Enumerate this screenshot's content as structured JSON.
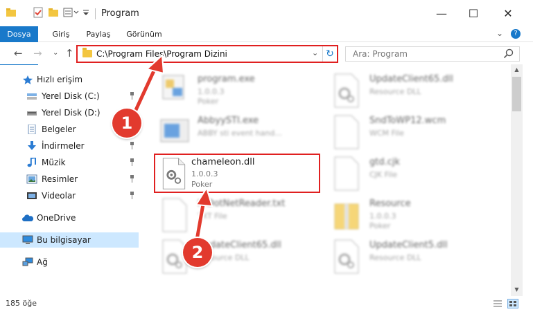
{
  "window": {
    "title": "Program",
    "minimize": "—",
    "maximize": "☐",
    "close": "✕"
  },
  "ribbon": {
    "tabs": [
      "Dosya",
      "Giriş",
      "Paylaş",
      "Görünüm"
    ],
    "expand_glyph": "⌄",
    "help_glyph": "?"
  },
  "navigation": {
    "back": "←",
    "forward": "→",
    "recent": "⌄",
    "up": "↑",
    "address": "C:\\Program Files\\Program Dizini",
    "address_dropdown": "⌄",
    "refresh": "↻",
    "search_placeholder": "Ara: Program"
  },
  "sidebar": {
    "items": [
      {
        "label": "Hızlı erişim",
        "icon": "star-icon",
        "pinned": false
      },
      {
        "label": "Yerel Disk (C:)",
        "icon": "drive-icon",
        "pinned": true
      },
      {
        "label": "Yerel Disk (D:)",
        "icon": "drive-icon",
        "pinned": true
      },
      {
        "label": "Belgeler",
        "icon": "documents-icon",
        "pinned": true
      },
      {
        "label": "İndirmeler",
        "icon": "download-icon",
        "pinned": true
      },
      {
        "label": "Müzik",
        "icon": "music-icon",
        "pinned": true
      },
      {
        "label": "Resimler",
        "icon": "pictures-icon",
        "pinned": true
      },
      {
        "label": "Videolar",
        "icon": "videos-icon",
        "pinned": true
      },
      {
        "label": "OneDrive",
        "icon": "cloud-icon",
        "pinned": false
      },
      {
        "label": "Bu bilgisayar",
        "icon": "computer-icon",
        "pinned": false
      },
      {
        "label": "Ağ",
        "icon": "network-icon",
        "pinned": false
      }
    ]
  },
  "files": [
    {
      "name": "program.exe",
      "line1": "1.0.0.3",
      "line2": "Poker",
      "icon": "exe-icon"
    },
    {
      "name": "UpdateClient65.dll",
      "line1": "Resource DLL",
      "line2": "",
      "icon": "dll-gear-icon"
    },
    {
      "name": "AbbyySTI.exe",
      "line1": "ABBY sti event hand...",
      "line2": "",
      "icon": "app-window-icon"
    },
    {
      "name": "SndToWP12.wcm",
      "line1": "WCM File",
      "line2": "",
      "icon": "blank-file-icon"
    },
    {
      "name": "chameleon.dll",
      "line1": "1.0.0.3",
      "line2": "Poker",
      "icon": "dll-gear-icon"
    },
    {
      "name": "gtd.cjk",
      "line1": "CJK File",
      "line2": "",
      "icon": "blank-file-icon"
    },
    {
      "name": "hrDotNetReader.txt",
      "line1": "TXT File",
      "line2": "",
      "icon": "blank-file-icon"
    },
    {
      "name": "Resource",
      "line1": "1.0.0.3",
      "line2": "Poker",
      "icon": "archive-icon"
    },
    {
      "name": "UpdateClient65.dll",
      "line1": "Resource DLL",
      "line2": "",
      "icon": "dll-gear-icon"
    },
    {
      "name": "UpdateClient5.dll",
      "line1": "Resource DLL",
      "line2": "",
      "icon": "dll-gear-icon"
    }
  ],
  "status": {
    "count": "185 öğe"
  },
  "callouts": [
    "1",
    "2"
  ],
  "colors": {
    "accent": "#1979ca",
    "highlight": "#e02020",
    "callout": "#e23a2e",
    "selected": "#cde8ff"
  }
}
